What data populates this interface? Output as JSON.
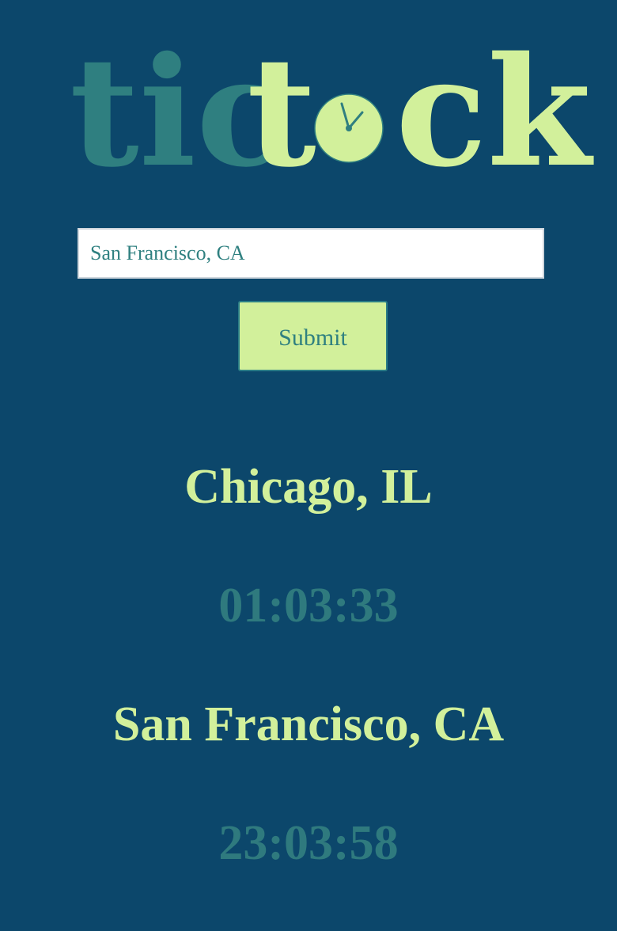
{
  "logo": {
    "part1": "tic",
    "part2_before": "t",
    "part2_after": "ck",
    "clock_icon": "clock-face-icon"
  },
  "search": {
    "value": "San Francisco, CA"
  },
  "submit": {
    "label": "Submit"
  },
  "clocks": [
    {
      "city": "Chicago, IL",
      "time": "01:03:33"
    },
    {
      "city": "San Francisco, CA",
      "time": "23:03:58"
    }
  ],
  "colors": {
    "background": "#0c476b",
    "accent_light": "#d2f09b",
    "accent_teal": "#2f7f80"
  }
}
